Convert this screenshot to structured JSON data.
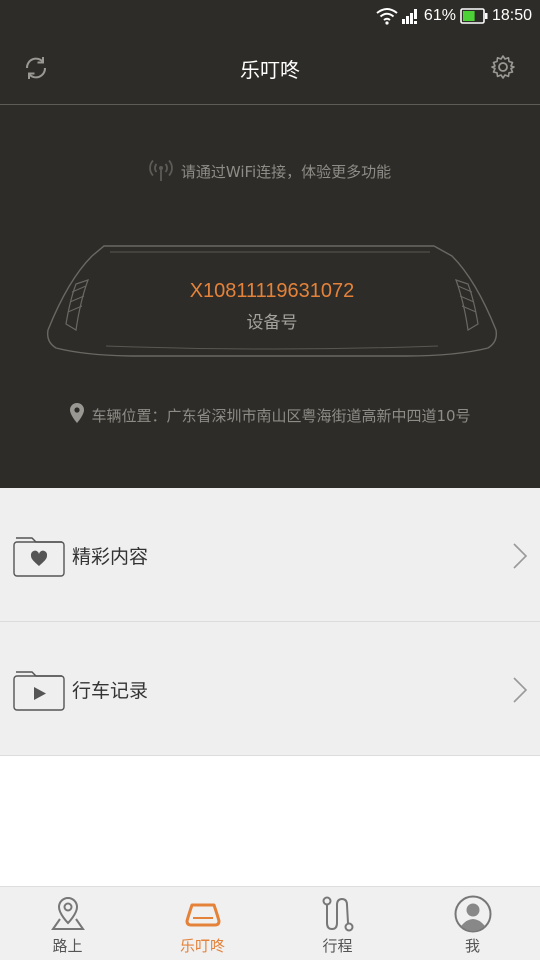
{
  "status_bar": {
    "battery_percent": "61%",
    "time": "18:50",
    "signal_icon": "signal-icon",
    "wifi_icon": "wifi-icon",
    "battery_icon": "battery-icon",
    "battery_level": 0.61
  },
  "header": {
    "title": "乐叮咚",
    "left_icon": "refresh-icon",
    "right_icon": "gear-icon"
  },
  "wifi_hint": {
    "text": "请通过WiFi连接，体验更多功能",
    "icon": "wifi-signal-icon"
  },
  "device": {
    "id": "X10811119631072",
    "label": "设备号"
  },
  "location": {
    "text": "车辆位置：广东省深圳市南山区粤海街道高新中四道10号",
    "icon": "location-pin-icon"
  },
  "list": [
    {
      "label": "精彩内容",
      "icon": "heart-folder-icon"
    },
    {
      "label": "行车记录",
      "icon": "video-folder-icon"
    }
  ],
  "tabs": [
    {
      "label": "路上",
      "icon": "map-pin-icon",
      "active": false
    },
    {
      "label": "乐叮咚",
      "icon": "device-icon",
      "active": true
    },
    {
      "label": "行程",
      "icon": "route-icon",
      "active": false
    },
    {
      "label": "我",
      "icon": "user-icon",
      "active": false
    }
  ],
  "colors": {
    "accent": "#e5823a",
    "header_bg": "#2d2c28",
    "list_bg": "#efefef"
  }
}
